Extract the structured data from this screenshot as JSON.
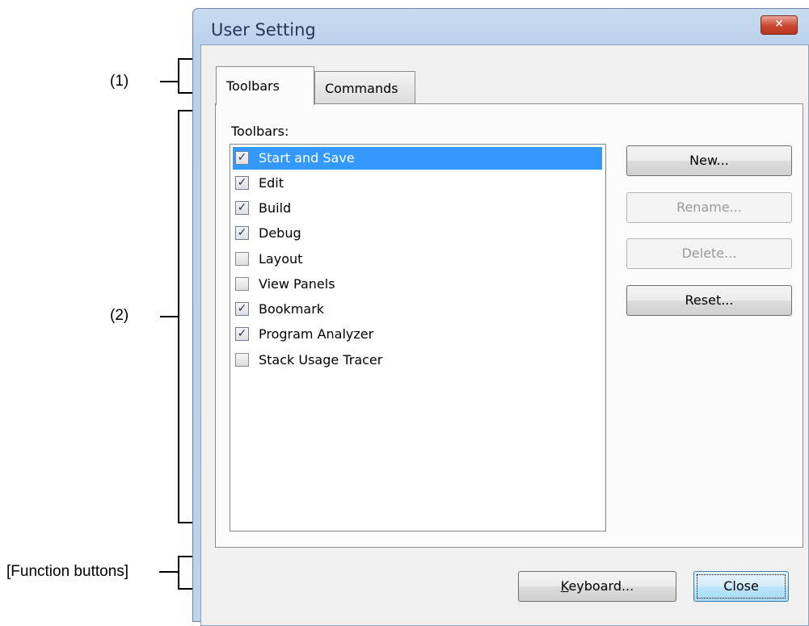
{
  "annotations": {
    "label_1": "(1)",
    "label_2": "(2)",
    "label_function": "[Function buttons]"
  },
  "window": {
    "title": "User Setting",
    "close_glyph": "✕"
  },
  "tabs": [
    {
      "label": "Toolbars",
      "active": true
    },
    {
      "label": "Commands",
      "active": false
    }
  ],
  "toolbars_panel": {
    "group_label": "Toolbars:",
    "items": [
      {
        "label": "Start and Save",
        "checked": true,
        "selected": true
      },
      {
        "label": "Edit",
        "checked": true,
        "selected": false
      },
      {
        "label": "Build",
        "checked": true,
        "selected": false
      },
      {
        "label": "Debug",
        "checked": true,
        "selected": false
      },
      {
        "label": "Layout",
        "checked": false,
        "selected": false
      },
      {
        "label": "View Panels",
        "checked": false,
        "selected": false
      },
      {
        "label": "Bookmark",
        "checked": true,
        "selected": false
      },
      {
        "label": "Program Analyzer",
        "checked": true,
        "selected": false
      },
      {
        "label": "Stack Usage Tracer",
        "checked": false,
        "selected": false
      }
    ],
    "buttons": {
      "new": "New...",
      "rename": "Rename...",
      "delete": "Delete...",
      "reset": "Reset..."
    }
  },
  "function_buttons": {
    "keyboard": "Keyboard...",
    "keyboard_mnemonic": "K",
    "keyboard_rest": "eyboard...",
    "close": "Close"
  },
  "icons": {
    "checkmark": "✓"
  },
  "colors": {
    "selection": "#3399ff",
    "title_bar": "#bcd3ec",
    "close_button": "#c84730"
  }
}
